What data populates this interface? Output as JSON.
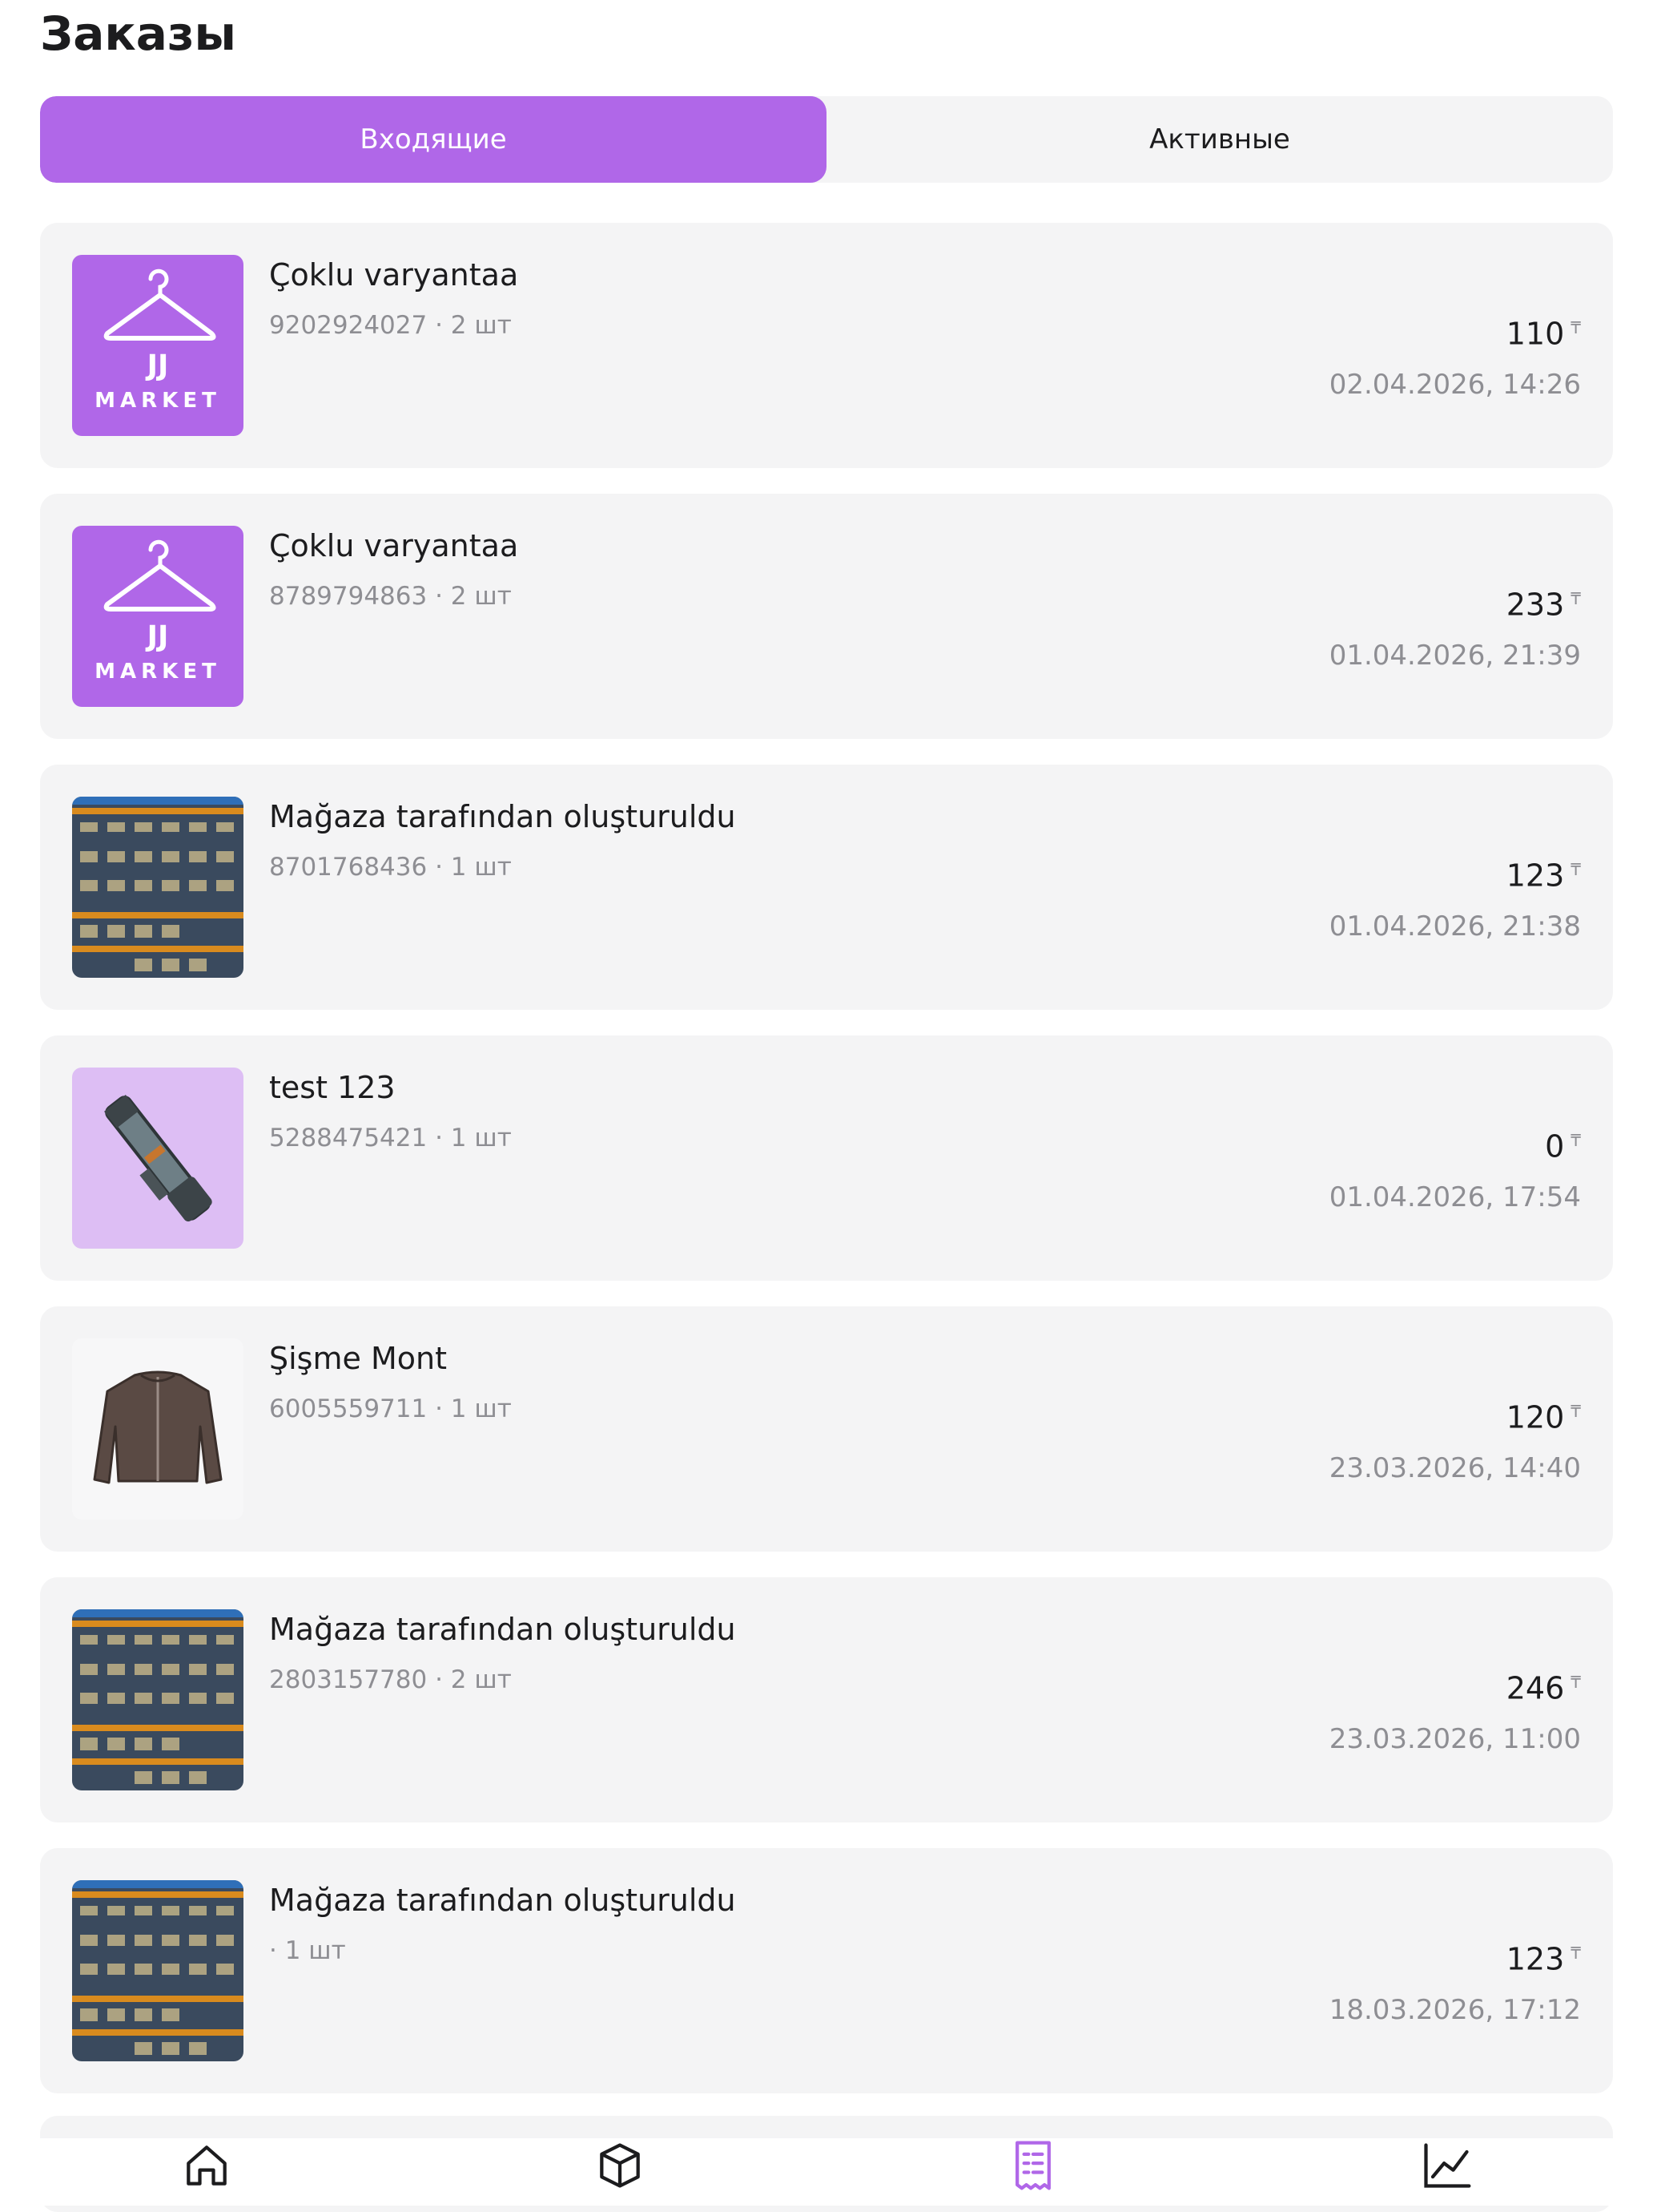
{
  "header": {
    "title": "Заказы"
  },
  "tabs": [
    {
      "label": "Входящие",
      "active": true
    },
    {
      "label": "Активные",
      "active": false
    }
  ],
  "colors": {
    "accent": "#B067E8",
    "card": "#F4F4F5",
    "muted": "#8E8E93"
  },
  "currency": "₸",
  "orders": [
    {
      "title": "Çoklu varyantaa",
      "meta": "9202924027 · 2 шт",
      "price": "110",
      "date": "02.04.2026, 14:26",
      "image": "jj-market-logo",
      "logo_text": {
        "top": "JJ",
        "bottom": "MARKET"
      }
    },
    {
      "title": "Çoklu varyantaa",
      "meta": "8789794863 · 2 шт",
      "price": "233",
      "date": "01.04.2026, 21:39",
      "image": "jj-market-logo",
      "logo_text": {
        "top": "JJ",
        "bottom": "MARKET"
      }
    },
    {
      "title": "Mağaza tarafından oluşturuldu",
      "meta": "8701768436 · 1 шт",
      "price": "123",
      "date": "01.04.2026, 21:38",
      "image": "weapons-grid"
    },
    {
      "title": "test 123",
      "meta": "5288475421 · 1 шт",
      "price": "0",
      "date": "01.04.2026, 17:54",
      "image": "launcher-item"
    },
    {
      "title": "Şişme Mont",
      "meta": "6005559711 · 1 шт",
      "price": "120",
      "date": "23.03.2026, 14:40",
      "image": "jacket"
    },
    {
      "title": "Mağaza tarafından oluşturuldu",
      "meta": "2803157780 · 2 шт",
      "price": "246",
      "date": "23.03.2026, 11:00",
      "image": "weapons-grid"
    },
    {
      "title": "Mağaza tarafından oluşturuldu",
      "meta": " · 1 шт",
      "price": "123",
      "date": "18.03.2026, 17:12",
      "image": "weapons-grid"
    }
  ],
  "tabbar": [
    {
      "icon": "home-icon",
      "active": false
    },
    {
      "icon": "box-icon",
      "active": false
    },
    {
      "icon": "orders-receipt-icon",
      "active": true
    },
    {
      "icon": "analytics-chart-icon",
      "active": false
    }
  ]
}
